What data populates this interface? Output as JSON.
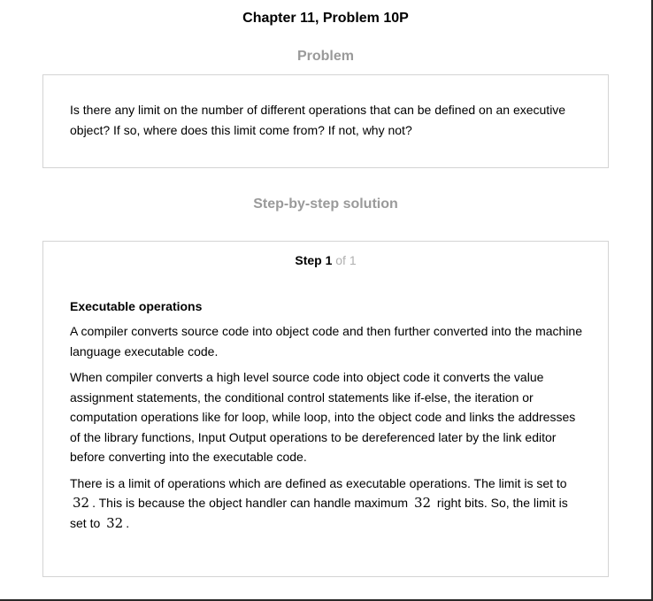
{
  "header": {
    "title": "Chapter 11, Problem 10P"
  },
  "problem": {
    "heading": "Problem",
    "text": "Is there any limit on the number of different operations that can be defined on an executive object? If so, where does this limit come from? If not, why not?"
  },
  "solution": {
    "heading": "Step-by-step solution",
    "step": {
      "label": "Step 1",
      "of": "of 1"
    },
    "section_title": "Executable operations",
    "paragraph1": "A compiler converts source code into object code and then further converted into the machine language executable code.",
    "paragraph2": "When compiler converts a high level source code into object code it converts the value assignment statements, the conditional control statements like if-else, the iteration or computation operations like for loop, while loop, into the object code and links the addresses of the library functions, Input Output operations to be dereferenced later by the link editor before converting into the executable code.",
    "paragraph3": {
      "part1": "There is a limit of operations which are defined as executable operations. The limit is set to",
      "value1": "32",
      "part2": ". This is because the object handler can handle maximum",
      "value2": "32",
      "part3": "right bits. So, the limit is set to",
      "value3": "32",
      "part4": "."
    }
  }
}
